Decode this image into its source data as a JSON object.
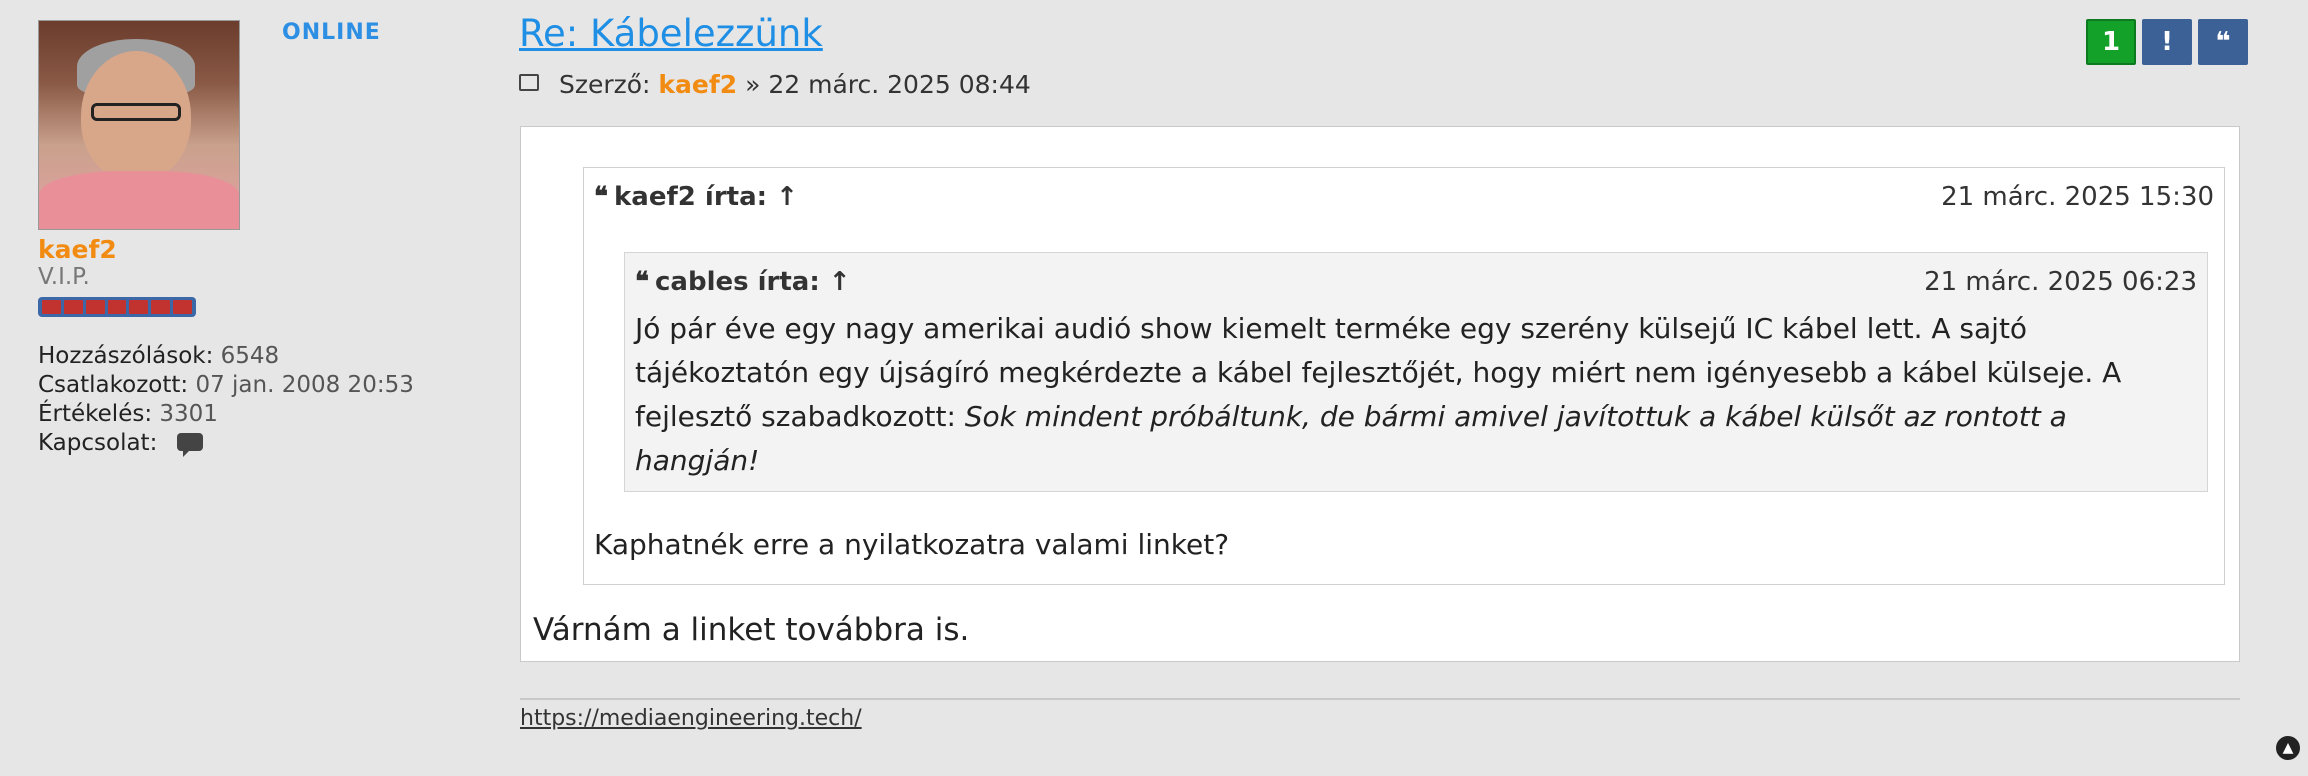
{
  "profile": {
    "online_label": "ONLINE",
    "username": "kaef2",
    "rank": "V.I.P.",
    "stats": [
      {
        "label": "Hozzászólások:",
        "value": "6548"
      },
      {
        "label": "Csatlakozott:",
        "value": "07 jan. 2008 20:53"
      },
      {
        "label": "Értékelés:",
        "value": "3301"
      },
      {
        "label": "Kapcsolat:",
        "value": ""
      }
    ]
  },
  "post": {
    "title": "Re: Kábelezzünk",
    "meta_label": "Szerző:",
    "meta_author": "kaef2",
    "meta_separator": "»",
    "meta_date": "22 márc. 2025 08:44",
    "actions": {
      "like_count": "1",
      "report_label": "!",
      "quote_label": "❝"
    },
    "outer_quote": {
      "author": "kaef2 írta: ↑",
      "date": "21 márc. 2025 15:30",
      "inner_quote": {
        "author": "cables írta: ↑",
        "date": "21 márc. 2025 06:23",
        "text_plain": "Jó pár éve egy nagy amerikai audió show kiemelt terméke egy szerény külsejű IC kábel lett. A sajtó tájékoztatón egy újságíró megkérdezte a kábel fejlesztőjét, hogy miért nem igényesebb a kábel külseje. A fejlesztő szabadkozott: ",
        "text_italic": "Sok mindent próbáltunk, de bármi amivel javítottuk a kábel külsőt az rontott a hangján!"
      },
      "reply": "Kaphatnék erre a nyilatkozatra valami linket?"
    },
    "body": "Várnám a linket továbbra is.",
    "signature_link": "https://mediaengineering.tech/"
  },
  "colors": {
    "accent": "#1f8fe5",
    "username": "#f28b12",
    "like_button": "#13a12a",
    "action_button": "#3b6196"
  }
}
